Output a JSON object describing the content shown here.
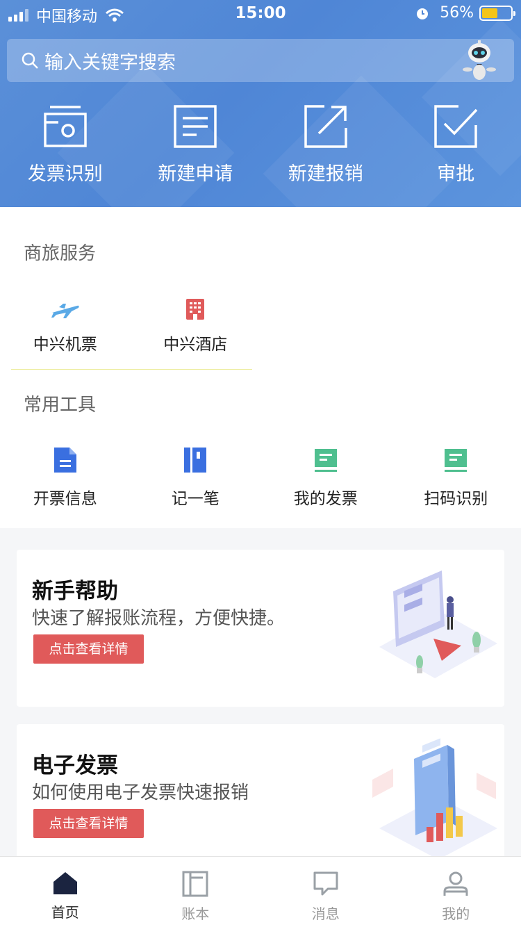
{
  "status_bar": {
    "carrier": "中国移动",
    "time": "15:00",
    "battery_text": "56%",
    "battery_level": 0.56
  },
  "search": {
    "placeholder": "输入关键字搜索",
    "icon": "search-icon",
    "assistant_icon": "robot-assistant-icon"
  },
  "quick_actions": [
    {
      "label": "发票识别",
      "icon": "invoice-scan-icon"
    },
    {
      "label": "新建申请",
      "icon": "new-application-icon"
    },
    {
      "label": "新建报销",
      "icon": "new-reimbursement-icon"
    },
    {
      "label": "审批",
      "icon": "approval-icon"
    }
  ],
  "business_travel": {
    "title": "商旅服务",
    "items": [
      {
        "label": "中兴机票",
        "icon": "airplane-icon",
        "color": "#5aa9e6"
      },
      {
        "label": "中兴酒店",
        "icon": "hotel-icon",
        "color": "#e05a5a"
      }
    ]
  },
  "tools": {
    "title": "常用工具",
    "items": [
      {
        "label": "开票信息",
        "icon": "document-icon",
        "color": "#3a6fe0"
      },
      {
        "label": "记一笔",
        "icon": "notebook-icon",
        "color": "#3a6fe0"
      },
      {
        "label": "我的发票",
        "icon": "invoice-icon",
        "color": "#4fbf8f"
      },
      {
        "label": "扫码识别",
        "icon": "scan-code-icon",
        "color": "#4fbf8f"
      }
    ]
  },
  "cards": [
    {
      "title": "新手帮助",
      "description": "快速了解报账流程，方便快捷。",
      "button": "点击查看详情"
    },
    {
      "title": "电子发票",
      "description": "如何使用电子发票快速报销",
      "button": "点击查看详情"
    }
  ],
  "tabbar": [
    {
      "label": "首页",
      "icon": "home-icon",
      "active": true
    },
    {
      "label": "账本",
      "icon": "ledger-icon",
      "active": false
    },
    {
      "label": "消息",
      "icon": "message-icon",
      "active": false
    },
    {
      "label": "我的",
      "icon": "profile-icon",
      "active": false
    }
  ],
  "colors": {
    "header": "#4f86d6",
    "button_red": "#e05a5a",
    "tab_active": "#1b2440",
    "tab_inactive": "#9aa0a6"
  }
}
